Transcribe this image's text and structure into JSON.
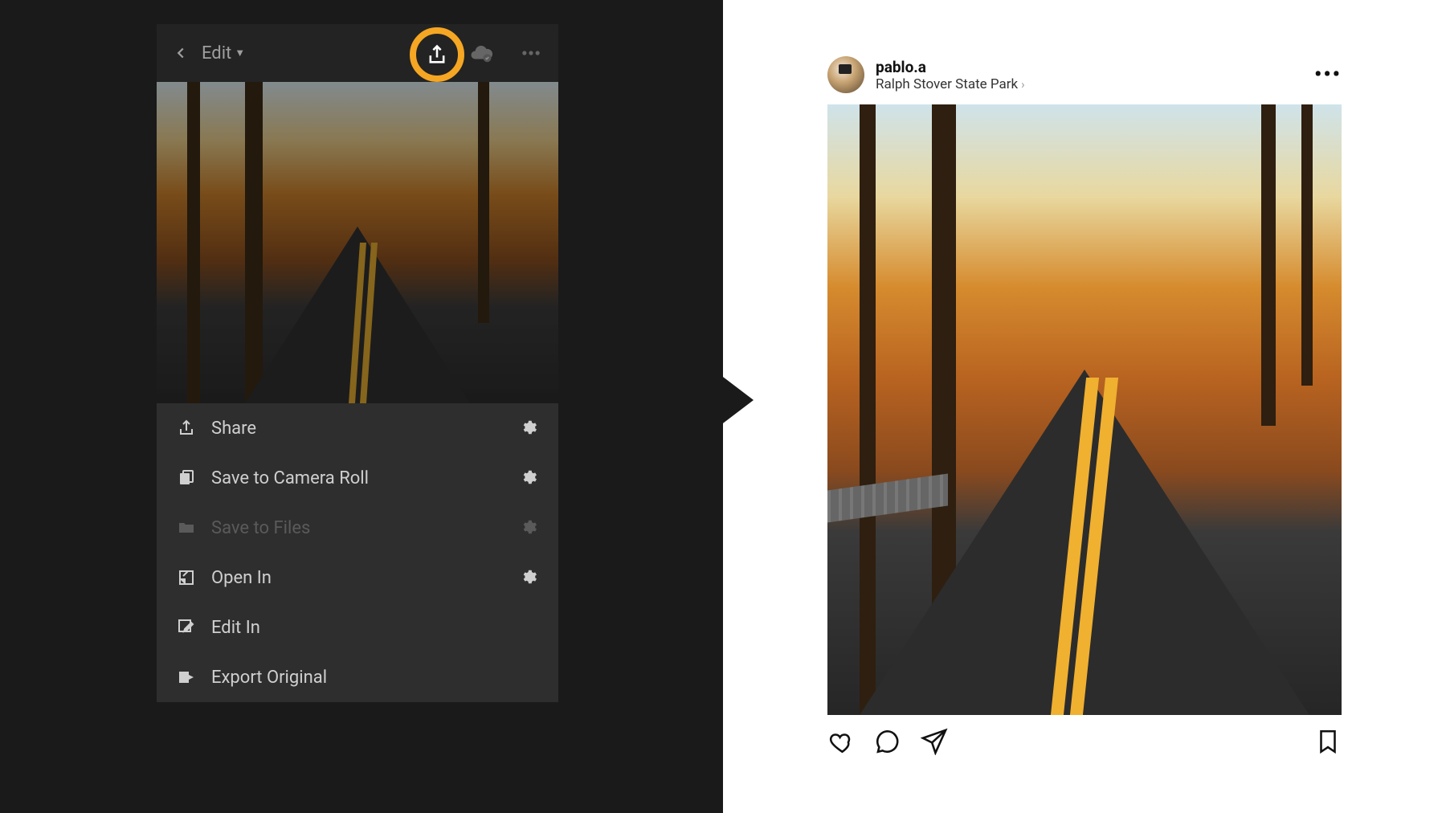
{
  "highlight_color": "#f5a623",
  "lightroom": {
    "topbar": {
      "edit_label": "Edit",
      "icons": {
        "back": "chevron-left",
        "share": "share-up-arrow",
        "cloud": "cloud-check",
        "more": "ellipsis"
      }
    },
    "share_menu": [
      {
        "icon": "share-icon",
        "label": "Share",
        "has_gear": true,
        "enabled": true
      },
      {
        "icon": "save-roll-icon",
        "label": "Save to Camera Roll",
        "has_gear": true,
        "enabled": true
      },
      {
        "icon": "folder-icon",
        "label": "Save to Files",
        "has_gear": true,
        "enabled": false
      },
      {
        "icon": "open-in-icon",
        "label": "Open In",
        "has_gear": true,
        "enabled": true
      },
      {
        "icon": "edit-in-icon",
        "label": "Edit In",
        "has_gear": false,
        "enabled": true
      },
      {
        "icon": "export-icon",
        "label": "Export Original",
        "has_gear": false,
        "enabled": true
      }
    ]
  },
  "instagram": {
    "username": "pablo.a",
    "location": "Ralph Stover State Park",
    "actions": {
      "like": "heart-outline",
      "comment": "comment-bubble",
      "send": "paper-plane",
      "bookmark": "bookmark-outline",
      "more": "ellipsis"
    }
  }
}
